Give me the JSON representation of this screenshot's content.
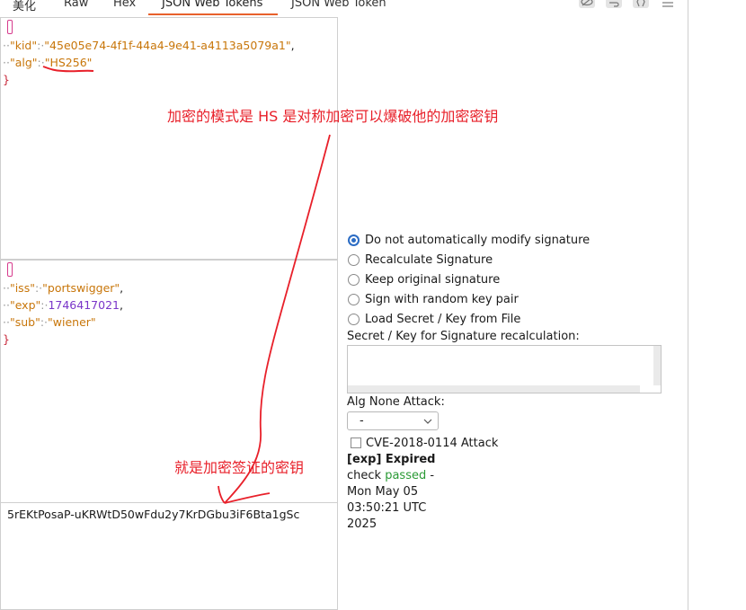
{
  "tabs": [
    {
      "label": "美化"
    },
    {
      "label": "Raw"
    },
    {
      "label": "Hex"
    },
    {
      "label": "JSON Web Tokens",
      "active": true
    },
    {
      "label": "JSON Web Token"
    }
  ],
  "toolbar_icons": [
    "eye-off-icon",
    "wrap-icon",
    "code-brackets-icon",
    "menu-icon"
  ],
  "header_json": {
    "open": "{",
    "kid_key": "\"kid\"",
    "kid_value": "\"45e05e74-4f1f-44a4-9e41-a4113a5079a1\"",
    "alg_key": "\"alg\"",
    "alg_value": "\"HS256\"",
    "close": "}"
  },
  "payload_json": {
    "open": "{",
    "iss_key": "\"iss\"",
    "iss_value": "\"portswigger\"",
    "exp_key": "\"exp\"",
    "exp_value": "1746417021",
    "sub_key": "\"sub\"",
    "sub_value": "\"wiener\"",
    "close": "}"
  },
  "signature": "5rEKtPosaP-uKRWtD50wFdu2y7KrDGbu3iF6Bta1gSc",
  "signature_options": [
    {
      "label": "Do not automatically modify signature",
      "selected": true
    },
    {
      "label": "Recalculate Signature",
      "selected": false
    },
    {
      "label": "Keep original signature",
      "selected": false
    },
    {
      "label": "Sign with random key pair",
      "selected": false
    },
    {
      "label": "Load Secret / Key from File",
      "selected": false
    }
  ],
  "secret_label": "Secret / Key for Signature recalculation:",
  "secret_value": "",
  "alg_none_label": "Alg None Attack:",
  "alg_none_selected": "-",
  "cve_label": "CVE-2018-0114 Attack",
  "cve_checked": false,
  "exp_status": {
    "tag": "[exp] Expired",
    "check": "check ",
    "passed": "passed",
    "dash": " -",
    "line1": "Mon May 05",
    "line2": "03:50:21 UTC",
    "line3": "2025"
  },
  "annotations": {
    "top": "加密的模式是 HS 是对称加密可以爆破他的加密密钥",
    "bottom": "就是加密签证的密钥"
  },
  "colors": {
    "accent": "#e8612c",
    "annotation": "#e8202a",
    "json_string": "#c8760a",
    "json_number": "#7a36c9",
    "radio_selected": "#2b6cc4",
    "passed": "#2a9a35"
  }
}
